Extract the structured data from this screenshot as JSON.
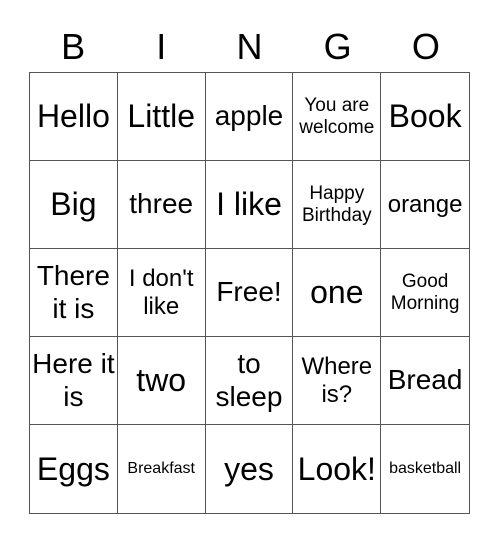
{
  "header": {
    "letters": [
      "B",
      "I",
      "N",
      "G",
      "O"
    ]
  },
  "cells": [
    [
      "Hello",
      "Little",
      "apple",
      "You are welcome",
      "Book"
    ],
    [
      "Big",
      "three",
      "I like",
      "Happy Birthday",
      "orange"
    ],
    [
      "There it is",
      "I don't like",
      "Free!",
      "one",
      "Good Morning"
    ],
    [
      "Here it is",
      "two",
      "to sleep",
      "Where is?",
      "Bread"
    ],
    [
      "Eggs",
      "Breakfast",
      "yes",
      "Look!",
      "basketball"
    ]
  ]
}
